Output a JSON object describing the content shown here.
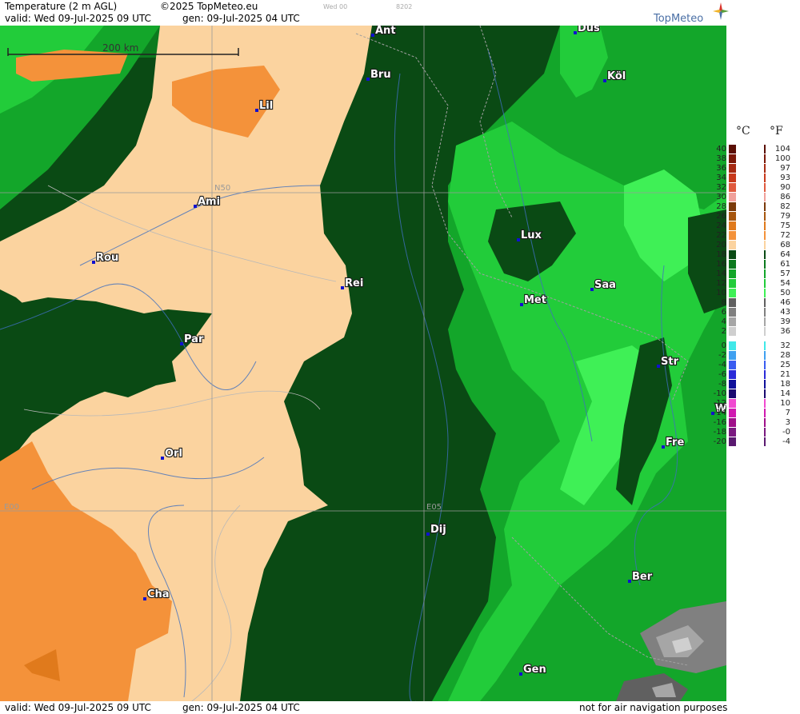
{
  "header": {
    "line1_title": "Temperature (2 m AGL)",
    "line1_copyright": "©2025 TopMeteo.eu",
    "line1_run": "Wed 00",
    "line1_code": "8202",
    "line2_valid": "valid:  Wed  09-Jul-2025  09 UTC",
    "line2_gen": "gen:  09-Jul-2025 04 UTC",
    "brand": "TopMeteo"
  },
  "map": {
    "scale_label": "200 km",
    "grid_labels": {
      "lat": "N50",
      "lon_left": "E00",
      "lon_mid": "E05"
    },
    "cities": [
      {
        "name": "Ant"
      },
      {
        "name": "Düs"
      },
      {
        "name": "Bru"
      },
      {
        "name": "Köl"
      },
      {
        "name": "Lil"
      },
      {
        "name": "Ami"
      },
      {
        "name": "Lux"
      },
      {
        "name": "Rou"
      },
      {
        "name": "Rei"
      },
      {
        "name": "Saa"
      },
      {
        "name": "Met"
      },
      {
        "name": "Par"
      },
      {
        "name": "Str"
      },
      {
        "name": "W"
      },
      {
        "name": "Fre"
      },
      {
        "name": "Orl"
      },
      {
        "name": "Dij"
      },
      {
        "name": "Ber"
      },
      {
        "name": "Cha"
      },
      {
        "name": "Gen"
      }
    ]
  },
  "legend": {
    "unit_c": "°C",
    "unit_f": "°F",
    "steps": [
      {
        "c": "40",
        "f": "104",
        "color": "#5a0f05"
      },
      {
        "c": "38",
        "f": "100",
        "color": "#7a1808"
      },
      {
        "c": "36",
        "f": "97",
        "color": "#a62a12"
      },
      {
        "c": "34",
        "f": "93",
        "color": "#c8391b"
      },
      {
        "c": "32",
        "f": "90",
        "color": "#e05a3e"
      },
      {
        "c": "30",
        "f": "86",
        "color": "#f0a09a"
      },
      {
        "c": "28",
        "f": "82",
        "color": "#7a3a0a"
      },
      {
        "c": "26",
        "f": "79",
        "color": "#a7560e"
      },
      {
        "c": "24",
        "f": "75",
        "color": "#e07a1c"
      },
      {
        "c": "22",
        "f": "72",
        "color": "#f4923a"
      },
      {
        "c": "20",
        "f": "68",
        "color": "#fbd39f"
      },
      {
        "c": "18",
        "f": "64",
        "color": "#0a4a14"
      },
      {
        "c": "16",
        "f": "61",
        "color": "#0c7a1e"
      },
      {
        "c": "14",
        "f": "57",
        "color": "#13a62a"
      },
      {
        "c": "12",
        "f": "54",
        "color": "#22cc3a"
      },
      {
        "c": "10",
        "f": "50",
        "color": "#3ff056"
      },
      {
        "c": "8",
        "f": "46",
        "color": "#606060"
      },
      {
        "c": "6",
        "f": "43",
        "color": "#808080"
      },
      {
        "c": "4",
        "f": "39",
        "color": "#a6a6a6"
      },
      {
        "c": "2",
        "f": "36",
        "color": "#cfcfcf"
      },
      {
        "c": "0",
        "f": "32",
        "color": "#40e8e8"
      },
      {
        "c": "-2",
        "f": "28",
        "color": "#3fa0f0"
      },
      {
        "c": "-4",
        "f": "25",
        "color": "#3a5cf0"
      },
      {
        "c": "-6",
        "f": "21",
        "color": "#2a2ad8"
      },
      {
        "c": "-8",
        "f": "18",
        "color": "#10109a"
      },
      {
        "c": "-10",
        "f": "14",
        "color": "#1a0a70"
      },
      {
        "c": "-12",
        "f": "10",
        "color": "#f04ad0"
      },
      {
        "c": "-14",
        "f": "7",
        "color": "#d01ab0"
      },
      {
        "c": "-16",
        "f": "3",
        "color": "#a0108a"
      },
      {
        "c": "-18",
        "f": "-0",
        "color": "#7a1a80"
      },
      {
        "c": "-20",
        "f": "-4",
        "color": "#5a1a70"
      }
    ]
  },
  "footer": {
    "valid": "valid:  Wed  09-Jul-2025  09 UTC",
    "gen": "gen:  09-Jul-2025 04 UTC",
    "notice": "not for air navigation purposes"
  }
}
